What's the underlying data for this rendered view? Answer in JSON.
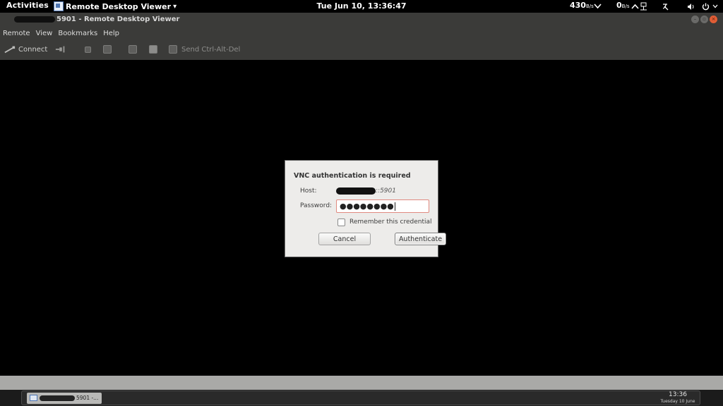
{
  "topbar": {
    "activities": "Activities",
    "app_name": "Remote Desktop Viewer",
    "app_menu_arrow": "▾",
    "clock": "Tue Jun 10, 13:36:47",
    "net_down": "430",
    "net_down_unit": "B/s",
    "net_up": "0",
    "net_up_unit": "B/s",
    "icons": [
      "chevron-down-icon",
      "chevron-up-icon",
      "network-icon",
      "input-method-icon",
      "volume-icon",
      "power-icon"
    ]
  },
  "window": {
    "title": "5901 - Remote Desktop Viewer",
    "controls": {
      "minimize": "–",
      "maximize": "▫",
      "close": "×"
    }
  },
  "menubar": {
    "items": [
      "Remote",
      "View",
      "Bookmarks",
      "Help"
    ]
  },
  "toolbar": {
    "connect_label": "Connect",
    "send_cad_label": "Send Ctrl-Alt-Del"
  },
  "dialog": {
    "title": "VNC authentication is required",
    "host_label": "Host:",
    "host_value": "::5901",
    "password_label": "Password:",
    "password_value": "●●●●●●●●",
    "remember_label": "Remember this credential",
    "remember_checked": false,
    "cancel_label": "Cancel",
    "authenticate_label": "Authenticate"
  },
  "taskbar": {
    "task_label": "5901 -...",
    "time": "13:36",
    "date": "Tuesday 10 June"
  },
  "colors": {
    "titlebar_bg": "#3b3b39",
    "close_button": "#e15d35",
    "dialog_bg": "#edecea",
    "password_border_error": "#e08a80",
    "statusbar_bg": "#a9a9a7"
  }
}
